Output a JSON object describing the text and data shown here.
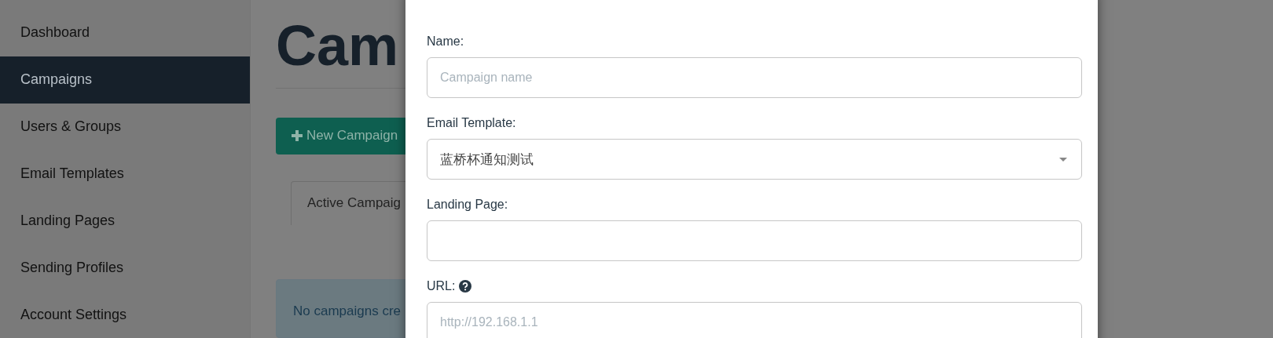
{
  "sidebar": {
    "items": [
      {
        "label": "Dashboard",
        "selected": false
      },
      {
        "label": "Campaigns",
        "selected": true
      },
      {
        "label": "Users & Groups",
        "selected": false
      },
      {
        "label": "Email Templates",
        "selected": false
      },
      {
        "label": "Landing Pages",
        "selected": false
      },
      {
        "label": "Sending Profiles",
        "selected": false
      },
      {
        "label": "Account Settings",
        "selected": false
      }
    ]
  },
  "page": {
    "title": "Cam",
    "new_button": "New Campaign",
    "tabs": [
      {
        "label": "Active Campaig",
        "selected": true
      }
    ],
    "alert": "No campaigns cre"
  },
  "modal": {
    "fields": [
      {
        "label": "Name:",
        "kind": "text",
        "placeholder": "Campaign name"
      },
      {
        "label": "Email Template:",
        "kind": "select",
        "value": "蓝桥杯通知测试"
      },
      {
        "label": "Landing Page:",
        "kind": "text"
      },
      {
        "label": "URL:",
        "kind": "text",
        "help": true,
        "placeholder": "http://192.168.1.1"
      }
    ]
  }
}
